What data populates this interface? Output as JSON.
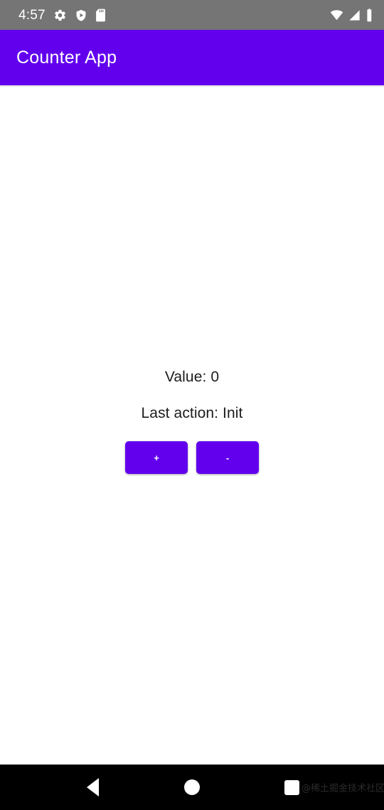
{
  "status_bar": {
    "time": "4:57",
    "left_icons": [
      "gear-icon",
      "play-protect-icon",
      "sd-card-icon"
    ],
    "right_icons": [
      "wifi-icon",
      "cellular-signal-icon",
      "battery-full-icon"
    ],
    "background_color": "#757575",
    "foreground_color": "#ffffff"
  },
  "app_bar": {
    "title": "Counter App",
    "background_color": "#6200ee",
    "title_color": "#ffffff"
  },
  "main": {
    "value_label": "Value: 0",
    "last_action_label": "Last action: Init",
    "text_color": "#1c1c1c",
    "background_color": "#ffffff",
    "buttons": [
      {
        "name": "increment-button",
        "label": "+",
        "color": "#6200ee"
      },
      {
        "name": "decrement-button",
        "label": "-",
        "color": "#6200ee"
      }
    ]
  },
  "nav_bar": {
    "background_color": "#000000",
    "back_icon": "back-triangle-icon",
    "home_icon": "home-circle-icon",
    "recents_icon": "recents-square-icon",
    "watermark": "@稀土掘金技术社区"
  }
}
